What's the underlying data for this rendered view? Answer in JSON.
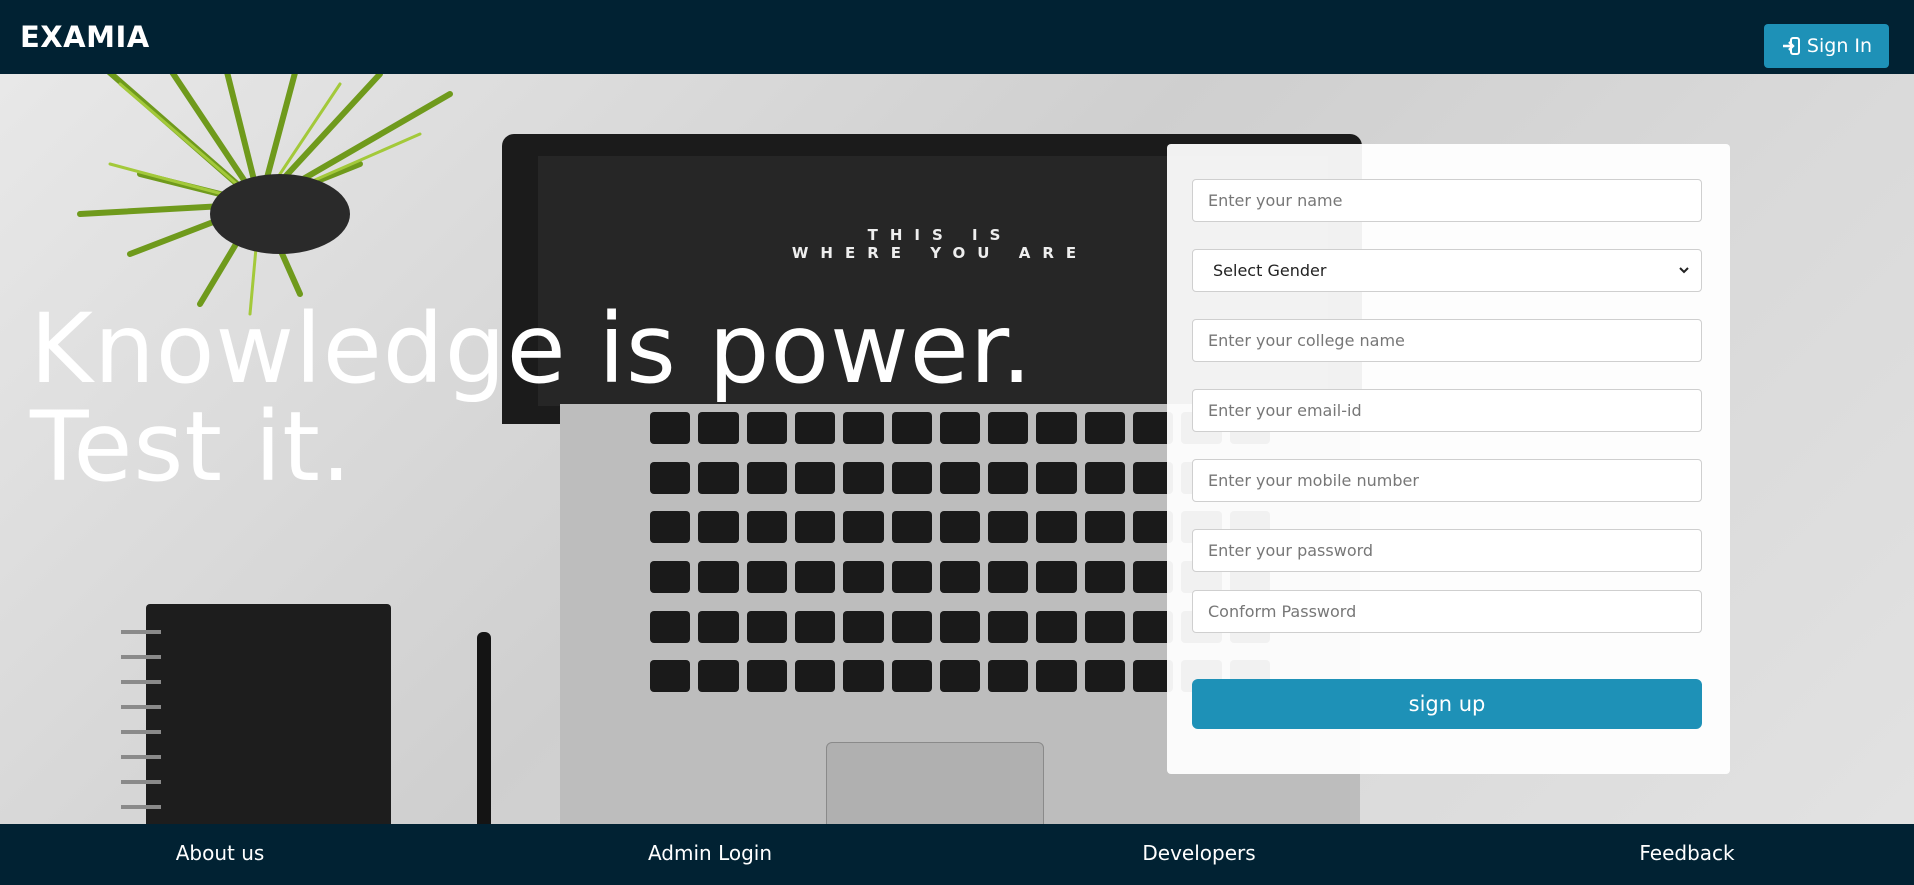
{
  "navbar": {
    "brand": "EXAMIA",
    "signin_label": "Sign In",
    "signin_icon": "sign-in-icon"
  },
  "hero": {
    "headline_line1": "Knowledge is power.",
    "headline_line2": "Test it.",
    "screen_line1": "THIS IS",
    "screen_line2": "WHERE YOU ARE"
  },
  "form": {
    "name_placeholder": "Enter your name",
    "gender_selected": "Select Gender",
    "college_placeholder": "Enter your college name",
    "email_placeholder": "Enter your email-id",
    "mobile_placeholder": "Enter your mobile number",
    "password_placeholder": "Enter your password",
    "confirm_placeholder": "Conform Password",
    "signup_label": "sign up"
  },
  "footer": {
    "links": [
      "About us",
      "Admin Login",
      "Developers",
      "Feedback"
    ]
  },
  "colors": {
    "nav_bg": "#012233",
    "accent": "#1e91b7"
  }
}
